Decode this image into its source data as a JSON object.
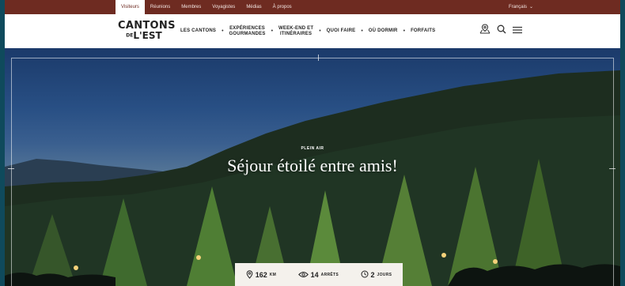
{
  "topbar": {
    "nav": [
      "Visiteurs",
      "Réunions",
      "Membres",
      "Voyagistes",
      "Médias",
      "À propos"
    ],
    "language": "Français"
  },
  "header": {
    "logo_line1": "CANTONS",
    "logo_de": "DE",
    "logo_line2": "L'EST",
    "nav": [
      {
        "l1": "LES CANTONS",
        "l2": ""
      },
      {
        "l1": "EXPÉRIENCES",
        "l2": "GOURMANDES"
      },
      {
        "l1": "WEEK-END ET",
        "l2": "ITINÉRAIRES"
      },
      {
        "l1": "QUOI FAIRE",
        "l2": ""
      },
      {
        "l1": "OÙ DORMIR",
        "l2": ""
      },
      {
        "l1": "FORFAITS",
        "l2": ""
      }
    ],
    "icons": [
      "map-pin-icon",
      "search-icon",
      "hamburger-menu-icon"
    ]
  },
  "hero": {
    "kicker": "PLEIN AIR",
    "title": "Séjour étoilé entre amis!",
    "stats": [
      {
        "icon": "location-icon",
        "value": "162",
        "unit": "KM"
      },
      {
        "icon": "eye-icon",
        "value": "14",
        "unit": "ARRÊTS"
      },
      {
        "icon": "clock-icon",
        "value": "2",
        "unit": "JOURS"
      }
    ]
  },
  "colors": {
    "topbar": "#6e2b21",
    "page_border": "#0f4a5c",
    "sky": "#284f84"
  }
}
